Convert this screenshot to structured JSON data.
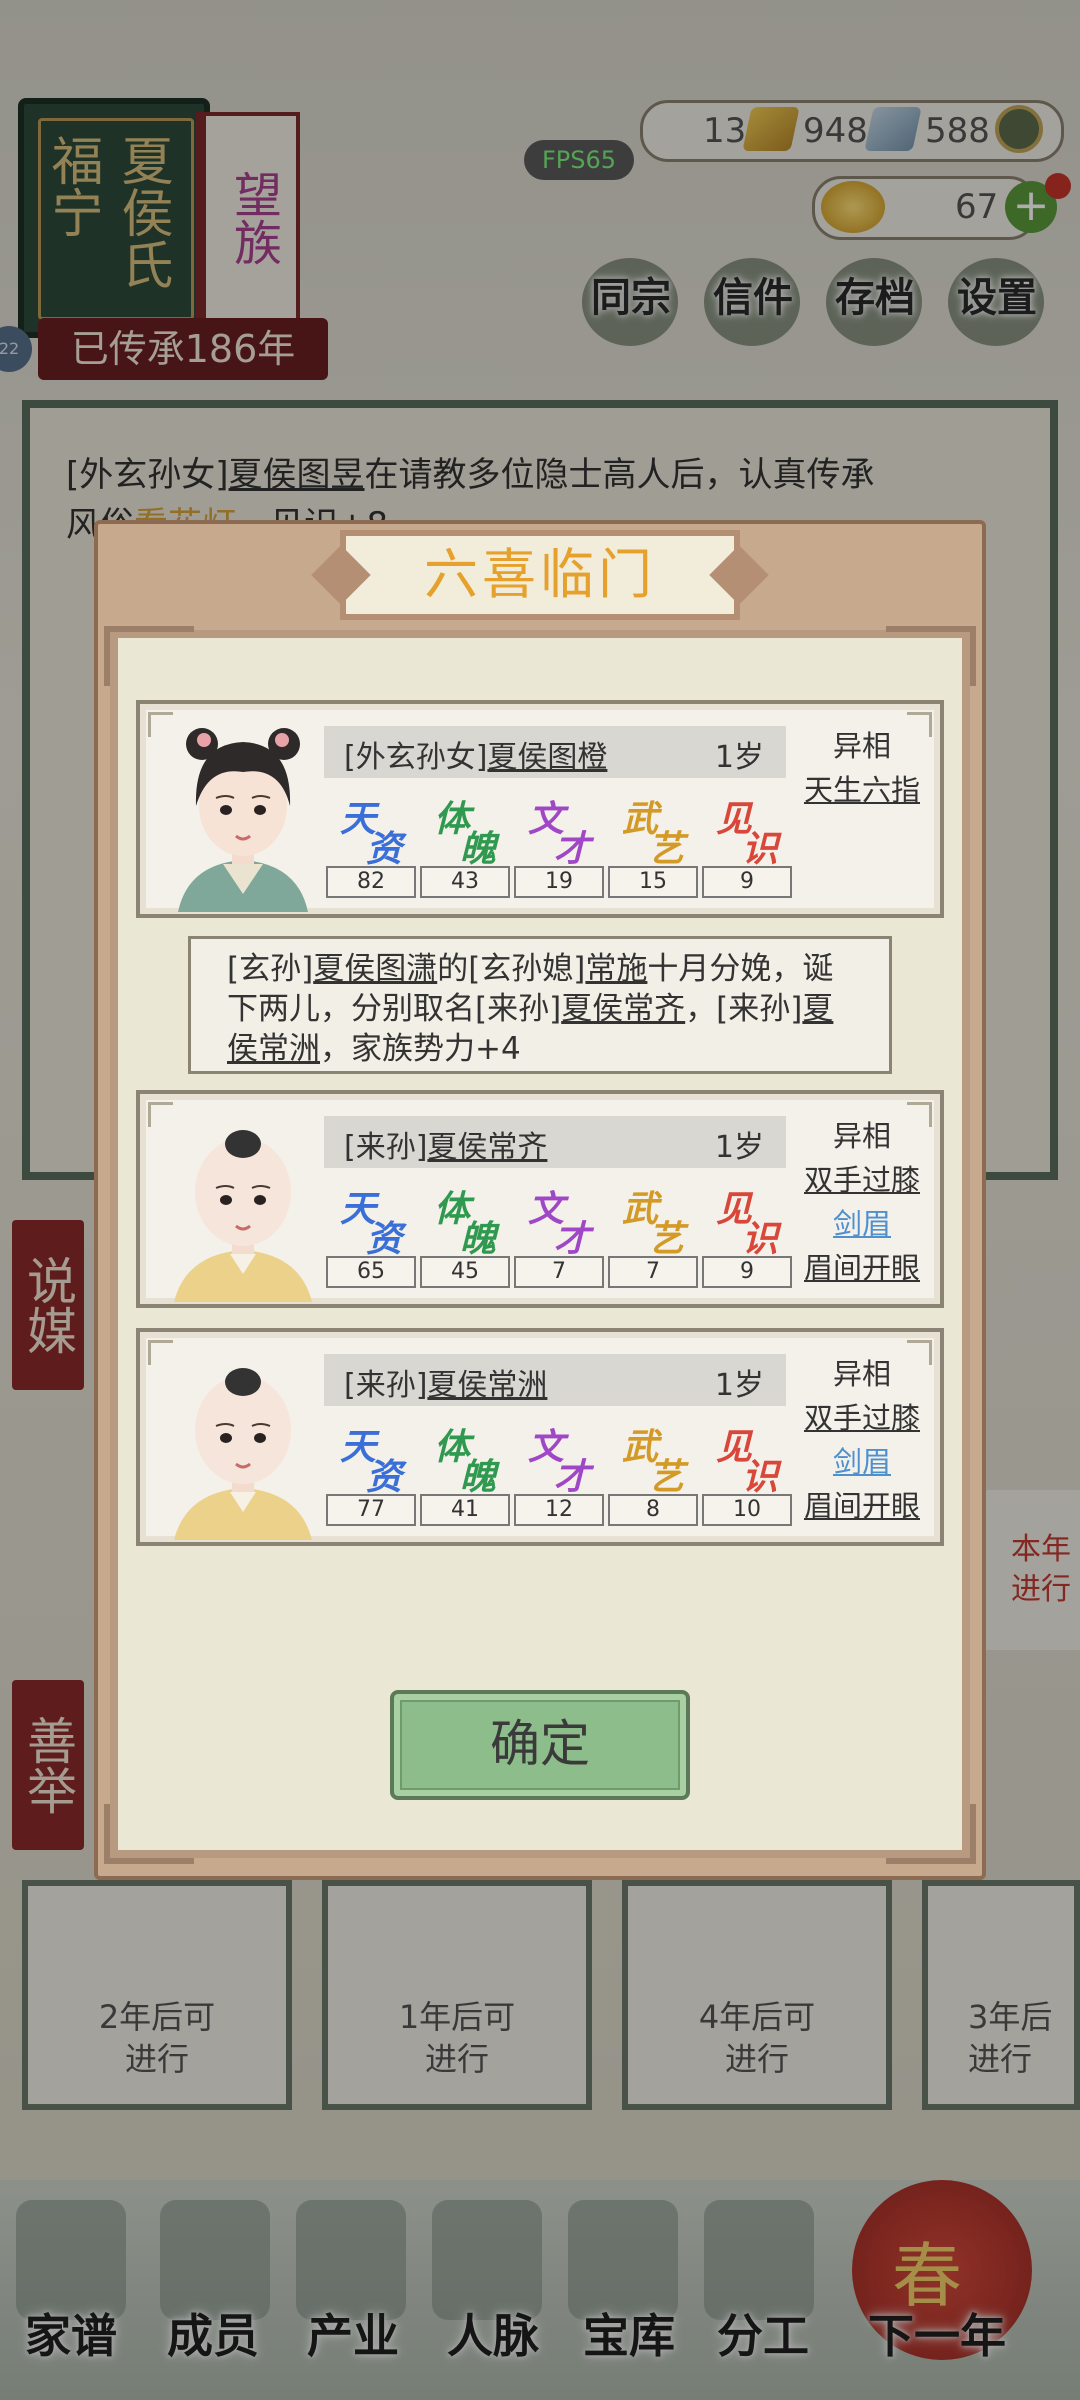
{
  "family": {
    "name_col1": "福宁",
    "name_col2": "夏侯氏",
    "rank": "望族",
    "inherit": "已传承186年",
    "badge": "22"
  },
  "fps": "FPS65",
  "resources": {
    "gold": "13",
    "silver": "948",
    "coins": "588",
    "ingot": "67"
  },
  "top_menu": [
    "同宗",
    "信件",
    "存档",
    "设置"
  ],
  "message": {
    "prefix": "[外玄孙女]",
    "person": "夏侯图昱",
    "text1": "在请教多位隐士高人后，认真传承",
    "text2": "风俗",
    "custom": "看花灯",
    "text3": "，见识+8"
  },
  "side_tabs": [
    "说媒",
    "善举"
  ],
  "activities": [
    {
      "text": "2年后可进行",
      "line1": "2年后可",
      "line2": "进行"
    },
    {
      "text": "1年后可进行",
      "line1": "1年后可",
      "line2": "进行"
    },
    {
      "text": "4年后可进行",
      "line1": "4年后可",
      "line2": "进行"
    },
    {
      "text": "3年后可进行",
      "line1": "3年后",
      "line2": "进行"
    }
  ],
  "right_card": {
    "line1": "本年",
    "line2": "进行"
  },
  "bottom_nav": [
    "家谱",
    "成员",
    "产业",
    "人脉",
    "宝库",
    "分工",
    "下一年"
  ],
  "lantern_char": "春",
  "dialog": {
    "title": "六喜临门",
    "ok": "确定",
    "stat_labels": [
      {
        "a": "天",
        "b": "资",
        "color": "#3a6fd8"
      },
      {
        "a": "体",
        "b": "魄",
        "color": "#2f9a4f"
      },
      {
        "a": "文",
        "b": "才",
        "color": "#a047c8"
      },
      {
        "a": "武",
        "b": "艺",
        "color": "#d39a28"
      },
      {
        "a": "见",
        "b": "识",
        "color": "#d8473a"
      }
    ],
    "event": {
      "p1": "[玄孙]",
      "n1": "夏侯图潇",
      "p2": "的[玄孙媳]",
      "n2": "常施",
      "p3": "十月分娩，诞下两儿，分别取名[来孙]",
      "n3": "夏侯常齐",
      "p4": "，[来孙]",
      "n4": "夏侯常洲",
      "p5": "，家族势力+4"
    },
    "people": [
      {
        "relation": "[外玄孙女]",
        "name": "夏侯图橙",
        "age": "1岁",
        "stats": [
          "82",
          "43",
          "19",
          "15",
          "9"
        ],
        "trait_title": "异相",
        "traits": [
          {
            "t": "天生六指",
            "style": "link"
          }
        ],
        "look": "girl"
      },
      {
        "relation": "[来孙]",
        "name": "夏侯常齐",
        "age": "1岁",
        "stats": [
          "65",
          "45",
          "7",
          "7",
          "9"
        ],
        "trait_title": "异相",
        "traits": [
          {
            "t": "双手过膝",
            "style": "link"
          },
          {
            "t": "剑眉",
            "style": "blue"
          },
          {
            "t": "眉间开眼",
            "style": "link"
          }
        ],
        "look": "baby"
      },
      {
        "relation": "[来孙]",
        "name": "夏侯常洲",
        "age": "1岁",
        "stats": [
          "77",
          "41",
          "12",
          "8",
          "10"
        ],
        "trait_title": "异相",
        "traits": [
          {
            "t": "双手过膝",
            "style": "link"
          },
          {
            "t": "剑眉",
            "style": "blue"
          },
          {
            "t": "眉间开眼",
            "style": "link"
          }
        ],
        "look": "baby"
      }
    ]
  }
}
